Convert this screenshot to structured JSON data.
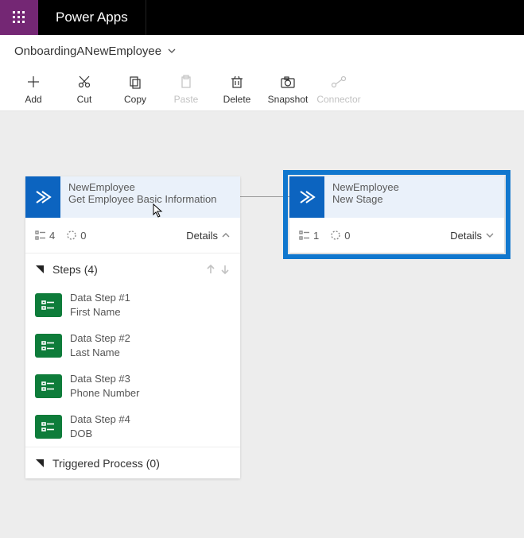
{
  "header": {
    "app_title": "Power Apps"
  },
  "breadcrumb": {
    "title": "OnboardingANewEmployee"
  },
  "toolbar": {
    "add": "Add",
    "cut": "Cut",
    "copy": "Copy",
    "paste": "Paste",
    "delete": "Delete",
    "snapshot": "Snapshot",
    "connector": "Connector"
  },
  "stage1": {
    "entity": "NewEmployee",
    "name": "Get Employee Basic Information",
    "step_count": "4",
    "process_count": "0",
    "details_label": "Details",
    "steps_header": "Steps (4)",
    "steps": [
      {
        "label": "Data Step #1",
        "field": "First Name"
      },
      {
        "label": "Data Step #2",
        "field": "Last Name"
      },
      {
        "label": "Data Step #3",
        "field": "Phone Number"
      },
      {
        "label": "Data Step #4",
        "field": "DOB"
      }
    ],
    "triggered_header": "Triggered Process (0)"
  },
  "stage2": {
    "entity": "NewEmployee",
    "name": "New Stage",
    "step_count": "1",
    "process_count": "0",
    "details_label": "Details"
  }
}
